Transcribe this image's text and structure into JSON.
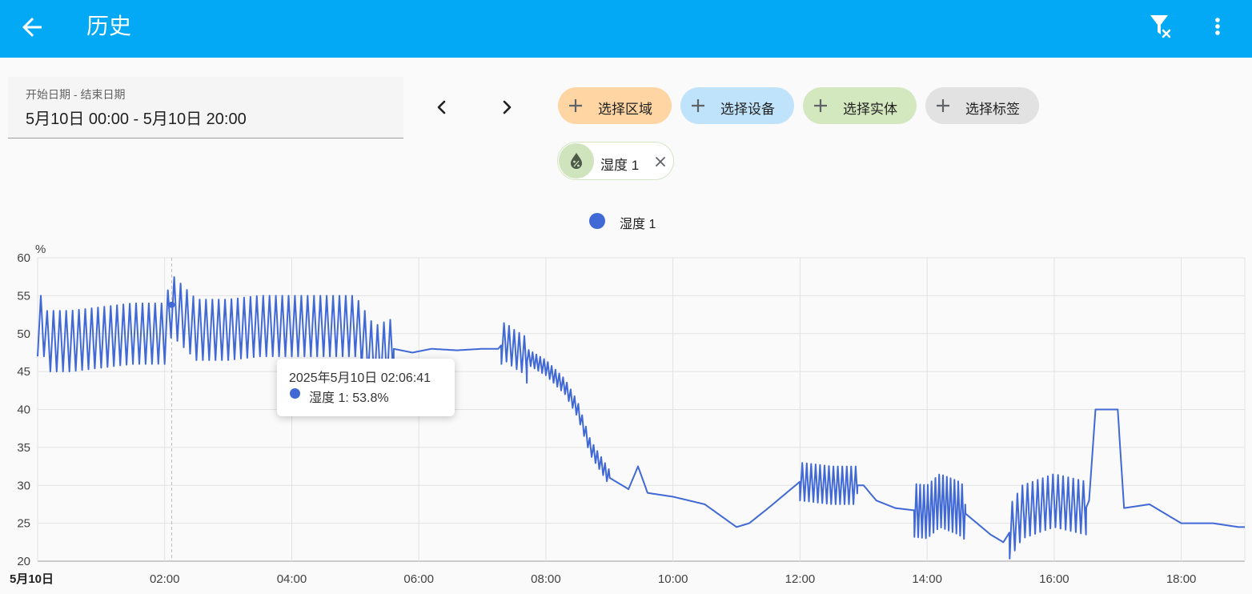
{
  "header": {
    "title": "历史",
    "back_icon": "arrow-left-icon",
    "filter_icon": "filter-remove-icon",
    "menu_icon": "dots-vertical-icon"
  },
  "date_range": {
    "label": "开始日期 - 结束日期",
    "value": "5月10日 00:00 - 5月10日 20:00"
  },
  "target_chips": [
    {
      "id": "area",
      "label": "选择区域",
      "color": "#ffd6a3"
    },
    {
      "id": "device",
      "label": "选择设备",
      "color": "#bfe3fa"
    },
    {
      "id": "entity",
      "label": "选择实体",
      "color": "#d4e8bf"
    },
    {
      "id": "label",
      "label": "选择标签",
      "color": "#e2e2e2"
    }
  ],
  "selected_entity": {
    "label": "湿度 1",
    "icon": "water-percent-icon"
  },
  "chart_data": {
    "type": "line",
    "legend": [
      "湿度 1"
    ],
    "legend_position": "top-center",
    "y_unit": "%",
    "ylim": [
      20,
      60
    ],
    "y_ticks": [
      "60",
      "55",
      "50",
      "45",
      "40",
      "35",
      "30",
      "25",
      "20"
    ],
    "x_ticks": [
      "5月10日",
      "02:00",
      "04:00",
      "06:00",
      "08:00",
      "10:00",
      "12:00",
      "14:00",
      "16:00",
      "18:00"
    ],
    "grid": true,
    "series": [
      {
        "name": "湿度 1",
        "color": "#4169d6",
        "hours": [
          0,
          0.1,
          0.15,
          0.3,
          0.5,
          1.0,
          1.5,
          2.0,
          2.11,
          2.5,
          3.0,
          3.5,
          4.0,
          4.5,
          5.0,
          5.3,
          5.6,
          5.9,
          6.2,
          6.6,
          7.0,
          7.25,
          7.35,
          7.5,
          7.7,
          8.0,
          8.3,
          8.5,
          8.7,
          9.0,
          9.3,
          9.45,
          9.6,
          10.0,
          10.5,
          11.0,
          11.2,
          11.5,
          12.0,
          12.5,
          13.0,
          13.2,
          13.5,
          14.0,
          14.2,
          14.5,
          15.0,
          15.2,
          15.5,
          16.0,
          16.5,
          16.55,
          16.65,
          17.0,
          17.1,
          17.5,
          18.0,
          18.5,
          18.9
        ],
        "values": [
          51,
          51,
          49,
          49,
          49,
          49.5,
          50,
          50,
          53.8,
          50.5,
          50.5,
          51,
          51,
          51,
          51,
          47,
          48,
          47.5,
          48,
          47.8,
          48,
          48,
          49,
          48,
          47,
          45.5,
          43,
          40,
          35,
          31,
          29.5,
          32.5,
          29,
          28.5,
          27.5,
          24.5,
          25,
          27,
          30.5,
          30,
          30,
          28,
          27,
          26.5,
          28,
          27,
          23.5,
          22.5,
          26.5,
          28,
          27,
          28,
          40,
          40,
          27,
          27.5,
          25,
          25,
          24.5
        ],
        "oscillation": {
          "segments": [
            {
              "from": 0.0,
              "to": 5.6,
              "period_h": 0.1,
              "amplitude": 4
            },
            {
              "from": 7.3,
              "to": 7.7,
              "period_h": 0.08,
              "amplitude": 2.5
            },
            {
              "from": 7.7,
              "to": 9.0,
              "period_h": 0.06,
              "amplitude": 1.0
            },
            {
              "from": 12.0,
              "to": 12.9,
              "period_h": 0.07,
              "amplitude": 2.5
            },
            {
              "from": 13.8,
              "to": 14.6,
              "period_h": 0.06,
              "amplitude": 3.5
            },
            {
              "from": 15.3,
              "to": 16.5,
              "period_h": 0.08,
              "amplitude": 3.5
            }
          ]
        }
      }
    ],
    "tooltip": {
      "title": "2025年5月10日 02:06:41",
      "text": "湿度 1: 53.8%",
      "hour": 2.11,
      "value": 53.8
    }
  }
}
